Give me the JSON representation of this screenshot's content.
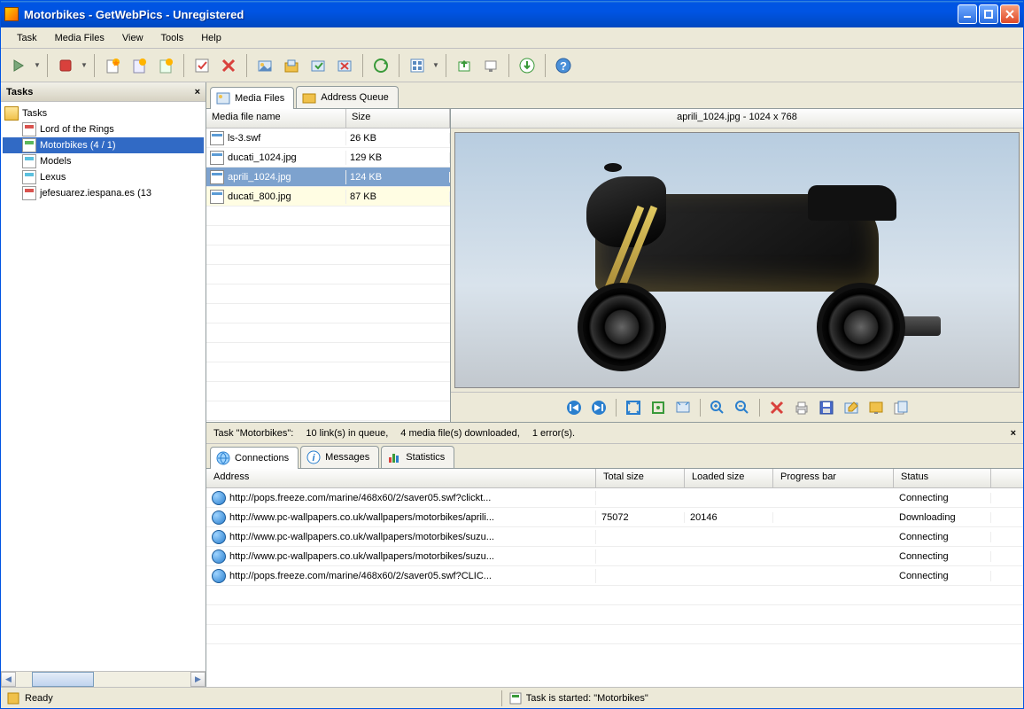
{
  "window": {
    "title": "Motorbikes - GetWebPics - Unregistered"
  },
  "menubar": {
    "items": [
      "Task",
      "Media Files",
      "View",
      "Tools",
      "Help"
    ]
  },
  "tasks_panel": {
    "title": "Tasks",
    "root": "Tasks",
    "items": [
      {
        "label": "Lord of the Rings",
        "icon": "doc-red"
      },
      {
        "label": "Motorbikes (4 / 1)",
        "icon": "doc-green",
        "selected": true
      },
      {
        "label": "Models",
        "icon": "doc-blue"
      },
      {
        "label": "Lexus",
        "icon": "doc-blue"
      },
      {
        "label": "jefesuarez.iespana.es (13",
        "icon": "doc-red"
      }
    ]
  },
  "content_tabs": {
    "tab1": "Media Files",
    "tab2": "Address Queue"
  },
  "file_list": {
    "columns": {
      "name": "Media file name",
      "size": "Size"
    },
    "rows": [
      {
        "name": "ls-3.swf",
        "size": "26 KB"
      },
      {
        "name": "ducati_1024.jpg",
        "size": "129 KB"
      },
      {
        "name": "aprili_1024.jpg",
        "size": "124 KB",
        "selected": true
      },
      {
        "name": "ducati_800.jpg",
        "size": "87 KB",
        "highlight": true
      }
    ]
  },
  "preview": {
    "title": "aprili_1024.jpg - 1024 x 768"
  },
  "task_status": {
    "prefix": "Task \"Motorbikes\":",
    "links": "10 link(s) in queue,",
    "downloaded": "4 media file(s) downloaded,",
    "errors": "1 error(s)."
  },
  "lower_tabs": {
    "tab1": "Connections",
    "tab2": "Messages",
    "tab3": "Statistics"
  },
  "connections": {
    "columns": {
      "address": "Address",
      "total": "Total size",
      "loaded": "Loaded size",
      "progress": "Progress bar",
      "status": "Status"
    },
    "rows": [
      {
        "address": "http://pops.freeze.com/marine/468x60/2/saver05.swf?clickt...",
        "total": "",
        "loaded": "",
        "status": "Connecting",
        "downloading": false
      },
      {
        "address": "http://www.pc-wallpapers.co.uk/wallpapers/motorbikes/aprili...",
        "total": "75072",
        "loaded": "20146",
        "status": "Downloading",
        "downloading": true
      },
      {
        "address": "http://www.pc-wallpapers.co.uk/wallpapers/motorbikes/suzu...",
        "total": "",
        "loaded": "",
        "status": "Connecting",
        "downloading": false
      },
      {
        "address": "http://www.pc-wallpapers.co.uk/wallpapers/motorbikes/suzu...",
        "total": "",
        "loaded": "",
        "status": "Connecting",
        "downloading": false
      },
      {
        "address": "http://pops.freeze.com/marine/468x60/2/saver05.swf?CLIC...",
        "total": "",
        "loaded": "",
        "status": "Connecting",
        "downloading": false
      }
    ]
  },
  "statusbar": {
    "left": "Ready",
    "right": "Task is started: \"Motorbikes\""
  }
}
